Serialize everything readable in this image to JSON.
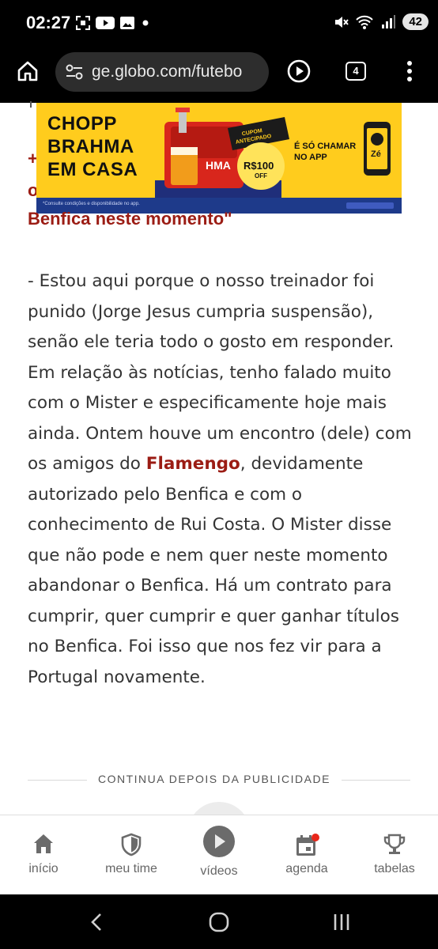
{
  "status_bar": {
    "time": "02:27",
    "battery": "42",
    "icons": [
      "screenshot-icon",
      "youtube-icon",
      "gallery-icon",
      "dot-icon",
      "mute-icon",
      "wifi-icon",
      "signal-icon"
    ]
  },
  "browser": {
    "url": "ge.globo.com/futebo",
    "tab_count": "4",
    "icons": [
      "home-icon",
      "site-settings-icon",
      "play-icon",
      "tabs-icon",
      "more-vert-icon"
    ]
  },
  "ad": {
    "brand_line1": "CHOPP",
    "brand_line2": "BRAHMA",
    "brand_line3": "EM CASA",
    "coupon_label": "CUPOM ANTECIPADO",
    "price": "R$100 OFF",
    "cta_line1": "É SÓ CHAMAR",
    "cta_line2": "NO APP",
    "footer_text": "*Consulte condições e disponibilidade no app."
  },
  "article": {
    "headline_last_line": "Benfica neste momento\"",
    "paragraph_before_link": "- Estou aqui porque o nosso treinador foi punido (Jorge Jesus cumpria suspensão), senão ele teria todo o gosto em responder. Em relação às notícias, tenho falado muito com o Mister e especificamente hoje mais ainda. Ontem houve um encontro (dele) com os amigos do ",
    "link_text": "Flamengo",
    "paragraph_after_link": ", devidamente autorizado pelo Benfica e com o conhecimento de Rui Costa. O Mister disse que não pode e nem quer neste momento abandonar o Benfica. Há um contrato para cumprir, quer cumprir e quer ganhar títulos no Benfica. Foi isso que nos fez vir para a Portugal novamente.",
    "ad_divider_label": "CONTINUA DEPOIS DA PUBLICIDADE"
  },
  "bottom_nav": {
    "items": [
      {
        "label": "início",
        "icon": "home-icon"
      },
      {
        "label": "meu time",
        "icon": "shield-icon"
      },
      {
        "label": "vídeos",
        "icon": "play-circle-icon"
      },
      {
        "label": "agenda",
        "icon": "calendar-icon"
      },
      {
        "label": "tabelas",
        "icon": "trophy-icon"
      }
    ],
    "colors": {
      "icon": "#6b6b6b",
      "badge": "#e8271a",
      "accent": "#9b1c14"
    }
  },
  "android_nav": {
    "icons": [
      "back-icon",
      "home-circle-icon",
      "recents-icon"
    ]
  }
}
